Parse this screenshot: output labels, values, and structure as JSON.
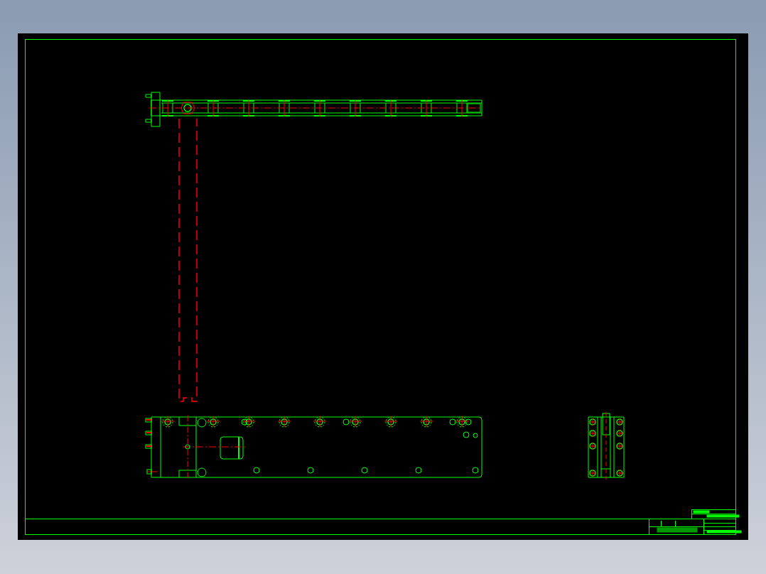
{
  "sheet": {
    "kind": "cad",
    "views": [
      {
        "kind": "top"
      },
      {
        "kind": "front"
      },
      {
        "kind": "side"
      }
    ]
  }
}
